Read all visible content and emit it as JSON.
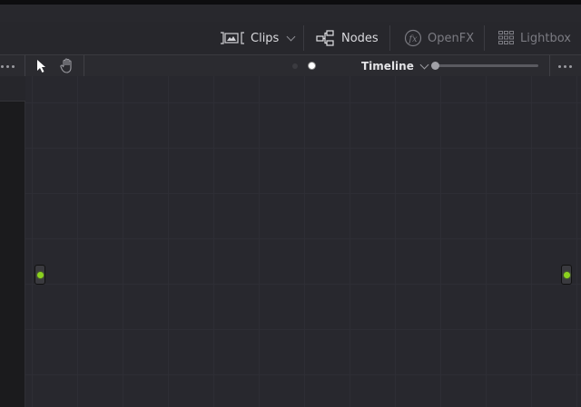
{
  "toolbar": {
    "clips_label": "Clips",
    "nodes_label": "Nodes",
    "openfx_label": "OpenFX",
    "lightbox_label": "Lightbox"
  },
  "node_editor": {
    "mode_label": "Timeline",
    "zoom_level": 0.0
  },
  "colors": {
    "accent_port": "#8bd21e",
    "canvas_bg": "#28282e",
    "toolbar_bg": "#27272c"
  },
  "icons": [
    "clips-icon",
    "nodes-icon",
    "openfx-icon",
    "lightbox-icon",
    "pointer-icon",
    "hand-icon",
    "more-options-icon",
    "chevron-down-icon"
  ]
}
